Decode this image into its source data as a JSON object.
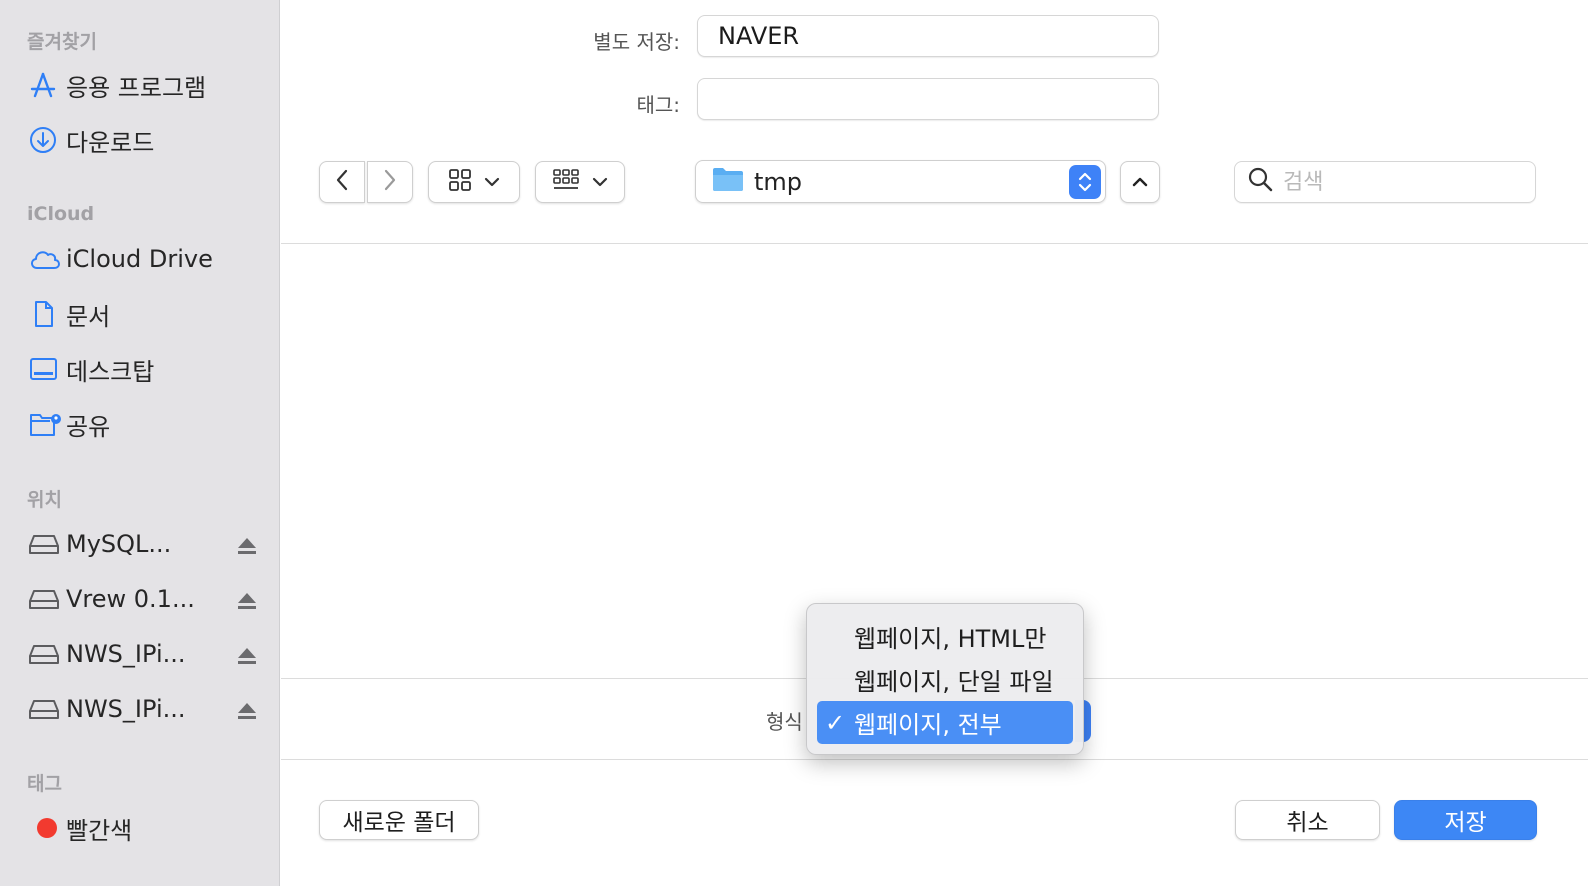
{
  "sidebar": {
    "favorites_title": "즐겨찾기",
    "favorites": [
      {
        "label": "응용 프로그램",
        "icon": "applications-icon"
      },
      {
        "label": "다운로드",
        "icon": "downloads-icon"
      }
    ],
    "icloud_title": "iCloud",
    "icloud": [
      {
        "label": "iCloud Drive",
        "icon": "icloud-icon"
      },
      {
        "label": "문서",
        "icon": "document-icon"
      },
      {
        "label": "데스크탑",
        "icon": "desktop-icon"
      },
      {
        "label": "공유",
        "icon": "shared-folder-icon"
      }
    ],
    "locations_title": "위치",
    "locations": [
      {
        "label": "MySQL...",
        "icon": "drive-icon"
      },
      {
        "label": "Vrew 0.1...",
        "icon": "drive-icon"
      },
      {
        "label": "NWS_IPi...",
        "icon": "drive-icon"
      },
      {
        "label": "NWS_IPi...",
        "icon": "drive-icon"
      }
    ],
    "tags_title": "태그",
    "tags": [
      {
        "label": "빨간색",
        "color": "#f23a2f"
      }
    ]
  },
  "save_as": {
    "label": "별도 저장:",
    "value": "NAVER"
  },
  "tags_field": {
    "label": "태그:",
    "value": ""
  },
  "toolbar": {
    "current_folder": "tmp",
    "search_placeholder": "검색"
  },
  "format": {
    "label": "형식",
    "options": [
      "웹페이지, HTML만",
      "웹페이지, 단일 파일",
      "웹페이지, 전부"
    ],
    "selected": "웹페이지, 전부",
    "check_mark": "✓"
  },
  "buttons": {
    "new_folder": "새로운 폴더",
    "cancel": "취소",
    "save": "저장"
  },
  "colors": {
    "accent": "#3d87f5",
    "sidebar_icon": "#2f7ff6"
  }
}
